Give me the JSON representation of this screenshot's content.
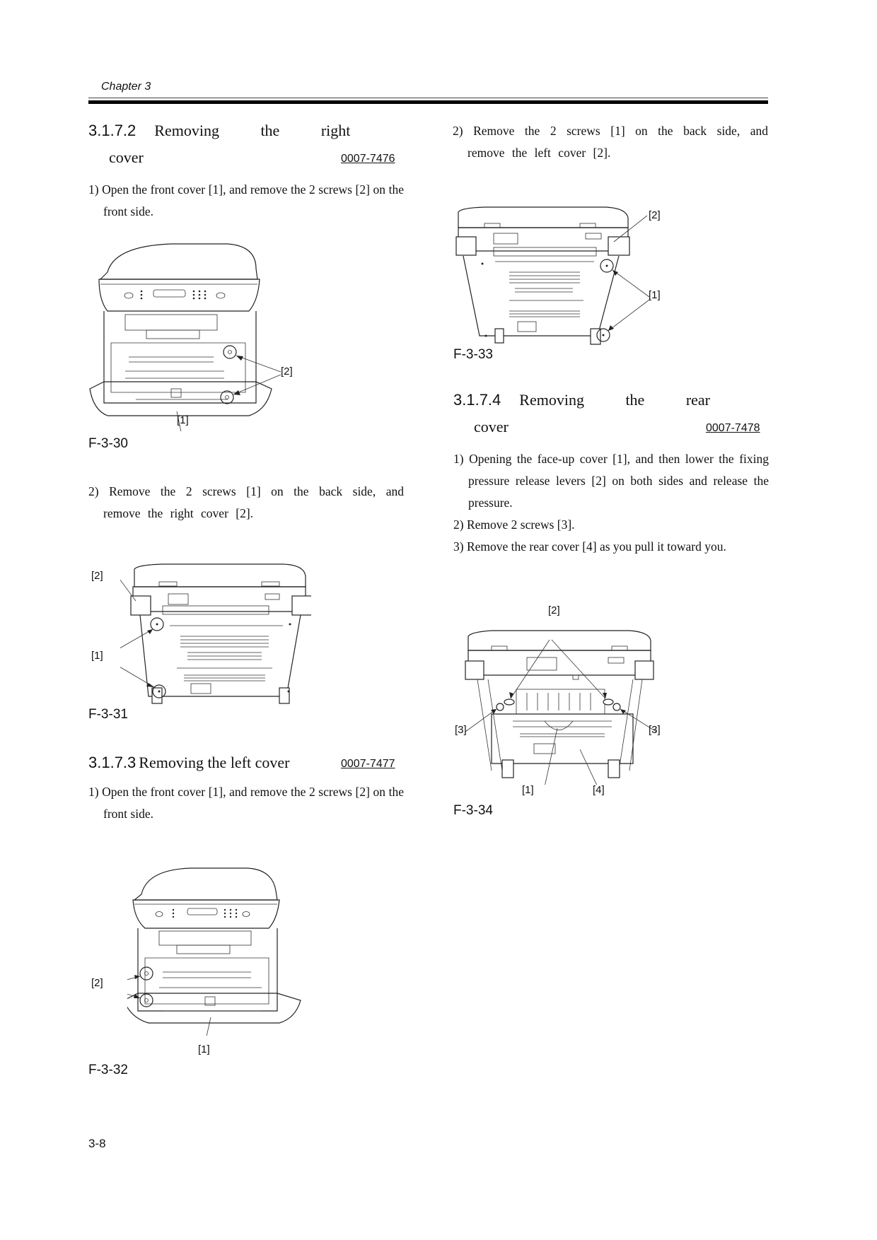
{
  "header": {
    "chapter": "Chapter 3"
  },
  "footer": {
    "page_number": "3-8"
  },
  "sections": [
    {
      "number": "3.1.7.2",
      "title_line1": "Removing   the   right",
      "title_line2": "cover",
      "code": "0007-7476",
      "steps": [
        "1) Open the front cover [1], and remove the 2 screws [2] on the front side.",
        "2) Remove the 2 screws [1] on the back side, and remove the right cover [2]."
      ],
      "figures": [
        {
          "caption": "F-3-30",
          "callouts": [
            "[2]",
            "[1]"
          ]
        },
        {
          "caption": "F-3-31",
          "callouts": [
            "[2]",
            "[1]"
          ]
        }
      ]
    },
    {
      "number": "3.1.7.3",
      "title_line1": "Removing the left cover",
      "code": "0007-7477",
      "steps": [
        "1) Open the front cover [1], and remove the 2 screws [2] on the front side.",
        "2) Remove the 2 screws [1] on the back side, and remove the left cover [2]."
      ],
      "figures": [
        {
          "caption": "F-3-32",
          "callouts": [
            "[2]",
            "[1]"
          ]
        },
        {
          "caption": "F-3-33",
          "callouts": [
            "[2]",
            "[1]"
          ]
        }
      ]
    },
    {
      "number": "3.1.7.4",
      "title_line1": "Removing   the   rear",
      "title_line2": "cover",
      "code": "0007-7478",
      "steps": [
        "1) Opening the face-up cover [1], and then lower the fixing pressure release levers [2] on both sides and release the pressure.",
        "2) Remove 2 screws [3].",
        "3) Remove the rear cover [4] as you pull it toward you."
      ],
      "figures": [
        {
          "caption": "F-3-34",
          "callouts": [
            "[2]",
            "[3]",
            "[3]",
            "[1]",
            "[4]"
          ]
        }
      ]
    }
  ]
}
